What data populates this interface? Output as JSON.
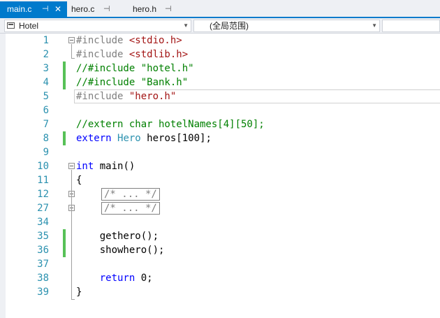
{
  "tabs": [
    {
      "label": "main.c",
      "pin": "⊣",
      "close": "✕",
      "active": true
    },
    {
      "label": "hero.c",
      "pin": "⊣",
      "active": false
    },
    {
      "label": "hero.h",
      "pin": "⊣",
      "active": false
    }
  ],
  "nav": {
    "scope": "Hotel",
    "context": "(全局范围)",
    "third": ""
  },
  "editor": {
    "lines": [
      {
        "num": "1",
        "tokens": [
          {
            "t": "#include ",
            "c": "pp"
          },
          {
            "t": "<stdio.h>",
            "c": "str"
          }
        ]
      },
      {
        "num": "2",
        "tokens": [
          {
            "t": "#include ",
            "c": "pp"
          },
          {
            "t": "<stdlib.h>",
            "c": "str"
          }
        ]
      },
      {
        "num": "3",
        "tokens": [
          {
            "t": "//#include \"hotel.h\"",
            "c": "cm"
          }
        ]
      },
      {
        "num": "4",
        "tokens": [
          {
            "t": "//#include \"Bank.h\"",
            "c": "cm"
          }
        ]
      },
      {
        "num": "5",
        "tokens": [
          {
            "t": "#include ",
            "c": "pp"
          },
          {
            "t": "\"hero.h\"",
            "c": "str"
          }
        ]
      },
      {
        "num": "6",
        "tokens": []
      },
      {
        "num": "7",
        "tokens": [
          {
            "t": "//extern char hotelNames[4][50];",
            "c": "cm"
          }
        ]
      },
      {
        "num": "8",
        "tokens": [
          {
            "t": "extern ",
            "c": "kw"
          },
          {
            "t": "Hero",
            "c": "ty"
          },
          {
            "t": " heros[100];",
            "c": ""
          }
        ]
      },
      {
        "num": "9",
        "tokens": []
      },
      {
        "num": "10",
        "tokens": [
          {
            "t": "int",
            "c": "kw"
          },
          {
            "t": " main()",
            "c": ""
          }
        ]
      },
      {
        "num": "11",
        "tokens": [
          {
            "t": "{",
            "c": ""
          }
        ]
      },
      {
        "num": "12",
        "collapsed": "/* ... */"
      },
      {
        "num": "27",
        "collapsed": "/* ... */"
      },
      {
        "num": "34",
        "tokens": []
      },
      {
        "num": "35",
        "tokens": [
          {
            "t": "    gethero();",
            "c": ""
          }
        ]
      },
      {
        "num": "36",
        "tokens": [
          {
            "t": "    showhero();",
            "c": ""
          }
        ]
      },
      {
        "num": "37",
        "tokens": []
      },
      {
        "num": "38",
        "tokens": [
          {
            "t": "    ",
            "c": ""
          },
          {
            "t": "return",
            "c": "kw"
          },
          {
            "t": " 0;",
            "c": ""
          }
        ]
      },
      {
        "num": "39",
        "tokens": [
          {
            "t": "}",
            "c": ""
          }
        ]
      }
    ],
    "changed_lines": [
      "3",
      "4",
      "8",
      "35",
      "36"
    ],
    "current_line": "5"
  },
  "colors": {
    "tab_active": "#007acc",
    "line_numbers": "#2b91af",
    "keyword": "#0000ff",
    "string": "#a31515",
    "comment": "#008000",
    "preprocessor": "#808080",
    "change_marker": "#57c157"
  }
}
